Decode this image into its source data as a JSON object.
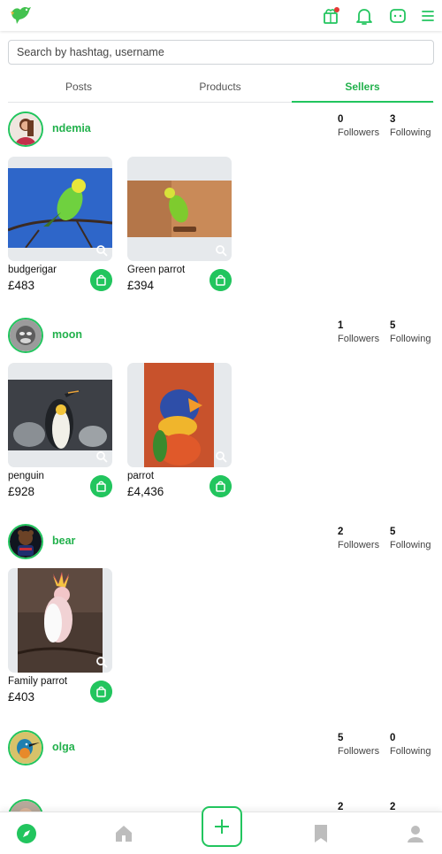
{
  "search": {
    "placeholder": "Search by hashtag, username"
  },
  "tabs": [
    {
      "label": "Posts"
    },
    {
      "label": "Products"
    },
    {
      "label": "Sellers"
    }
  ],
  "sellers": [
    {
      "name": "ndemia",
      "followers": "0",
      "followers_label": "Followers",
      "following": "3",
      "following_label": "Following",
      "products": [
        {
          "title": "budgerigar",
          "price": "£483"
        },
        {
          "title": "Green parrot",
          "price": "£394"
        }
      ]
    },
    {
      "name": "moon",
      "followers": "1",
      "followers_label": "Followers",
      "following": "5",
      "following_label": "Following",
      "products": [
        {
          "title": "penguin",
          "price": "£928"
        },
        {
          "title": "parrot",
          "price": "£4,436"
        }
      ]
    },
    {
      "name": "bear",
      "followers": "2",
      "followers_label": "Followers",
      "following": "5",
      "following_label": "Following",
      "products": [
        {
          "title": "Family parrot",
          "price": "£403"
        }
      ]
    },
    {
      "name": "olga",
      "followers": "5",
      "followers_label": "Followers",
      "following": "0",
      "following_label": "Following",
      "products": []
    },
    {
      "name": "",
      "followers": "2",
      "followers_label": "",
      "following": "2",
      "following_label": "",
      "products": []
    }
  ],
  "colors": {
    "accent": "#22c55e",
    "accent_text": "#22b14c",
    "notification_dot": "#e53935"
  },
  "icons": [
    "bird-logo-icon",
    "shop-icon",
    "bell-icon",
    "chat-icon",
    "menu-icon",
    "compass-icon",
    "home-icon",
    "plus-icon",
    "bookmark-icon",
    "profile-icon",
    "search-zoom-icon",
    "shopping-bag-icon"
  ]
}
